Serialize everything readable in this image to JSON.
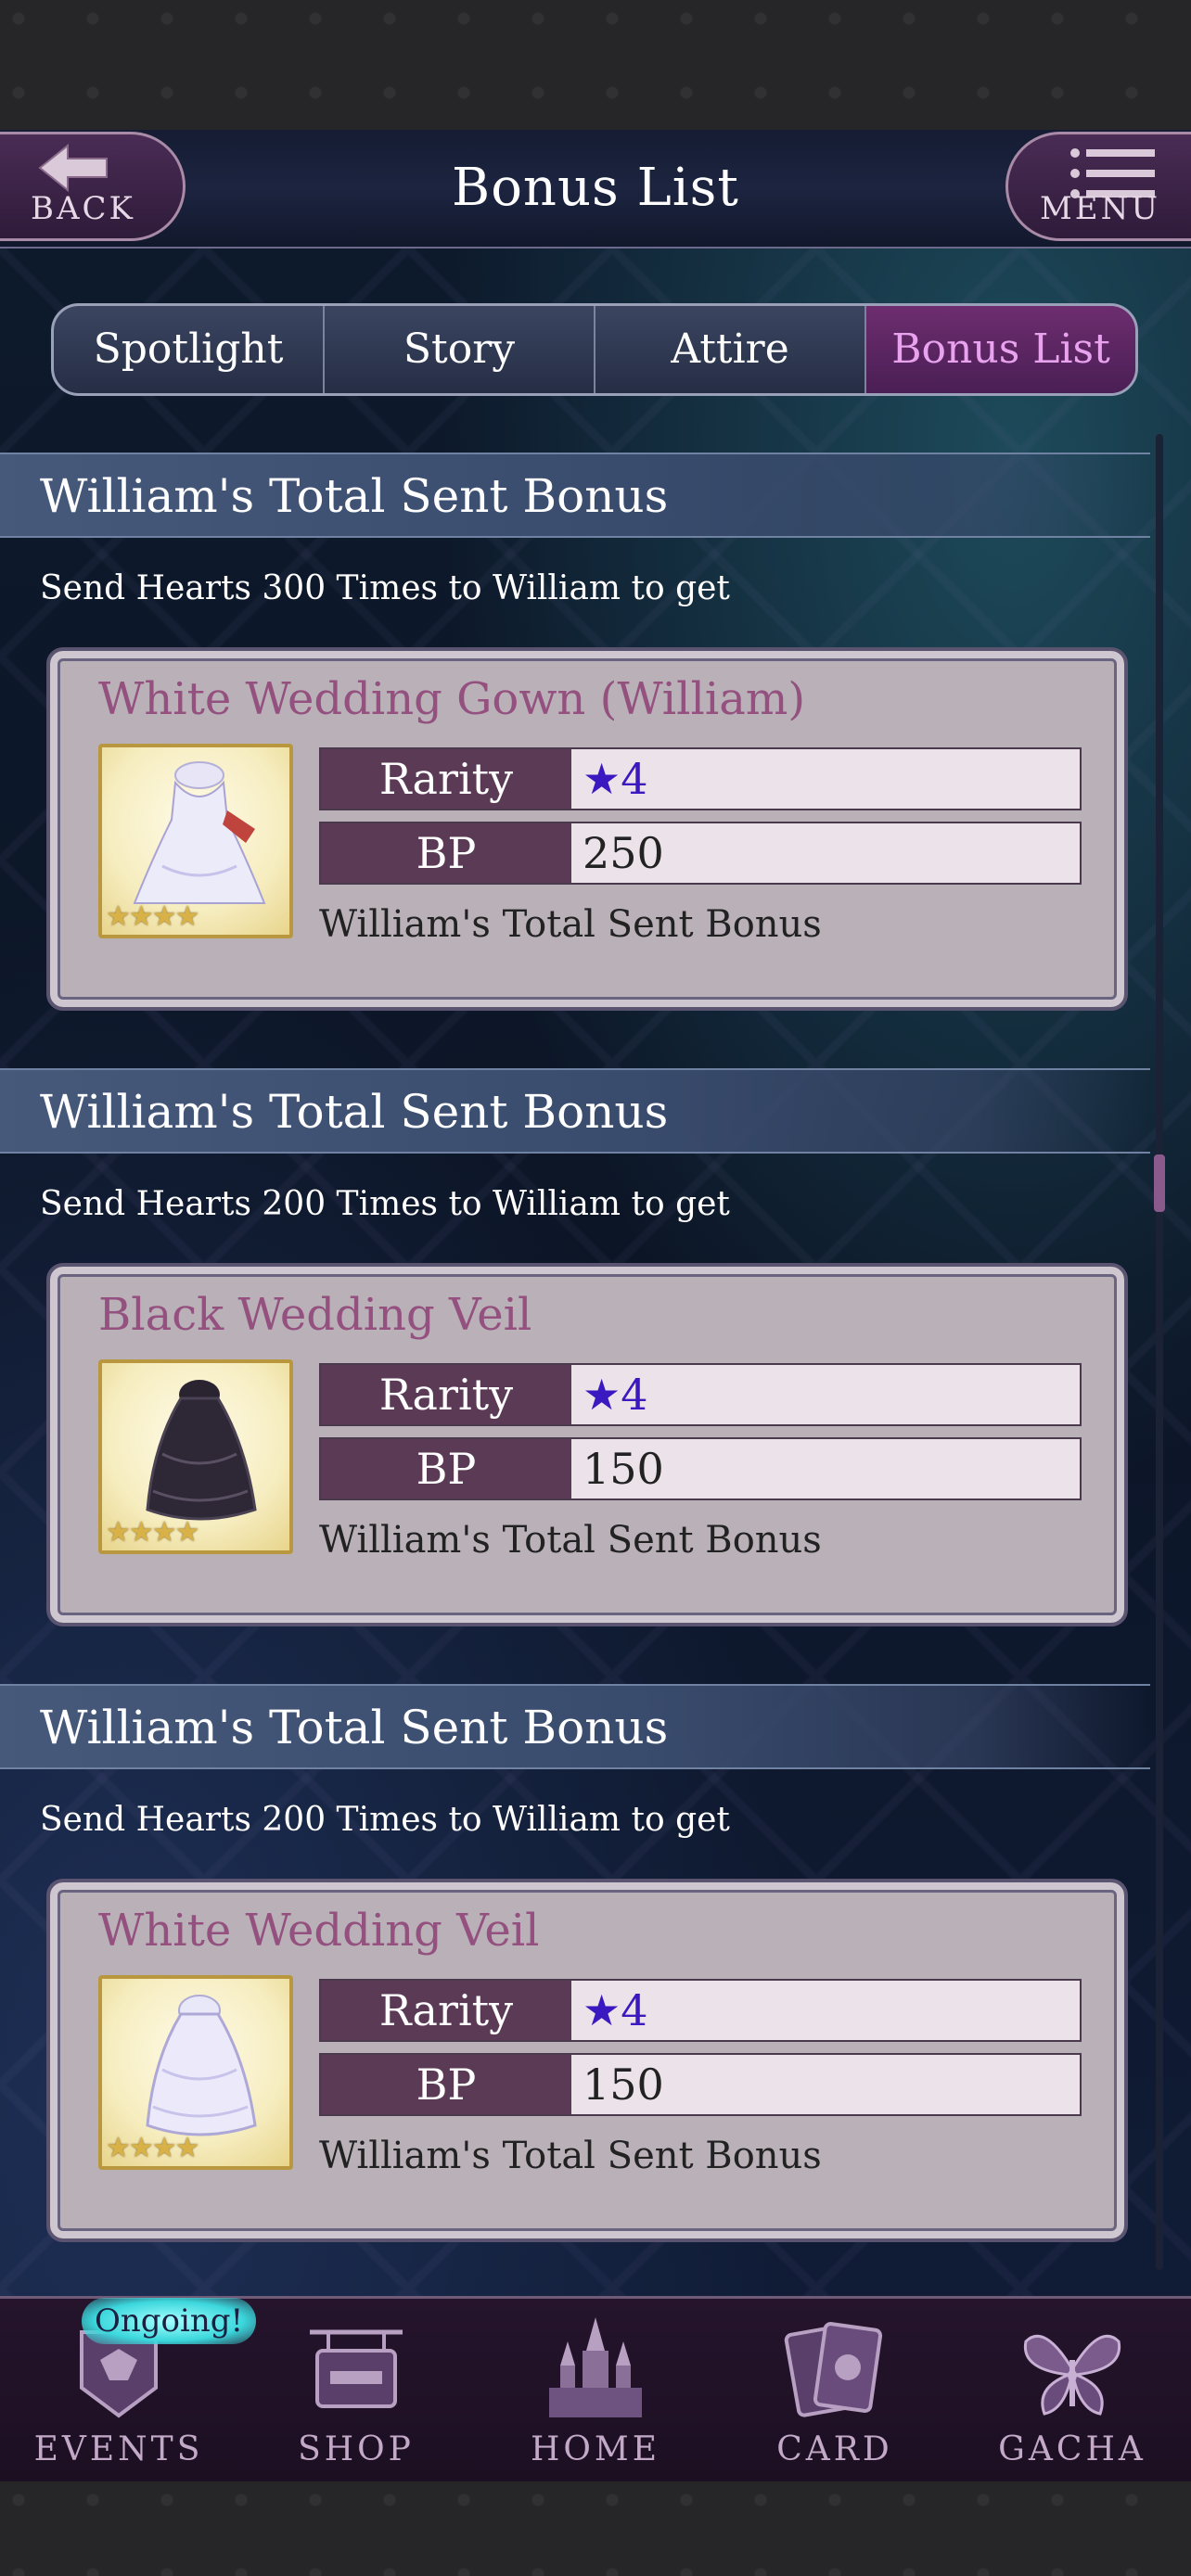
{
  "header": {
    "title": "Bonus List",
    "back_label": "BACK",
    "menu_label": "MENU"
  },
  "tabs": [
    {
      "label": "Spotlight",
      "active": false
    },
    {
      "label": "Story",
      "active": false
    },
    {
      "label": "Attire",
      "active": false
    },
    {
      "label": "Bonus List",
      "active": true
    }
  ],
  "sections": [
    {
      "title": "William's Total Sent Bonus",
      "subtitle": "Send Hearts 300 Times to William to get",
      "item": {
        "name": "White Wedding Gown (William)",
        "icon": "white-wedding-gown-icon",
        "stars": "★★★★",
        "rarity_label": "Rarity",
        "rarity_value": "★4",
        "bp_label": "BP",
        "bp_value": "250",
        "description": "William's Total Sent Bonus"
      }
    },
    {
      "title": "William's Total Sent Bonus",
      "subtitle": "Send Hearts 200 Times to William to get",
      "item": {
        "name": "Black Wedding Veil",
        "icon": "black-wedding-veil-icon",
        "stars": "★★★★",
        "rarity_label": "Rarity",
        "rarity_value": "★4",
        "bp_label": "BP",
        "bp_value": "150",
        "description": "William's Total Sent Bonus"
      }
    },
    {
      "title": "William's Total Sent Bonus",
      "subtitle": "Send Hearts 200 Times to William to get",
      "item": {
        "name": "White Wedding Veil",
        "icon": "white-wedding-veil-icon",
        "stars": "★★★★",
        "rarity_label": "Rarity",
        "rarity_value": "★4",
        "bp_label": "BP",
        "bp_value": "150",
        "description": "William's Total Sent Bonus"
      }
    }
  ],
  "bottom_nav": {
    "ongoing_badge": "Ongoing!",
    "items": [
      {
        "label": "EVENTS",
        "icon": "events-crest-icon"
      },
      {
        "label": "SHOP",
        "icon": "shop-sign-icon"
      },
      {
        "label": "HOME",
        "icon": "castle-icon"
      },
      {
        "label": "CARD",
        "icon": "cards-icon"
      },
      {
        "label": "GACHA",
        "icon": "butterfly-icon"
      }
    ]
  },
  "colors": {
    "accent": "#94507e",
    "active_tab": "#e8a2ee",
    "rarity_star": "#3a1ac0"
  }
}
